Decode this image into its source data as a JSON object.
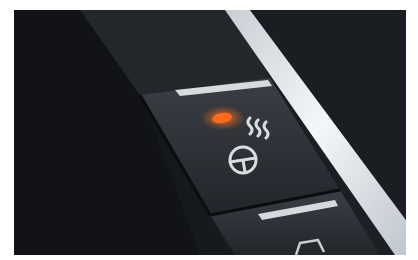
{
  "photo": {
    "subject": "car-console-switch-panel",
    "colors": {
      "background": "#ffffff",
      "panel_dark": "#1a1d21",
      "button_face": "#2b2f34",
      "indicator_on": "#ff6a1a",
      "icon_stroke": "#d9dde1",
      "chrome_strip": "#e9edf1"
    },
    "buttons": [
      {
        "icon": "heated-steering-wheel-icon",
        "indicator": "on"
      },
      {
        "icon": "car-icon",
        "indicator": "off"
      }
    ]
  }
}
